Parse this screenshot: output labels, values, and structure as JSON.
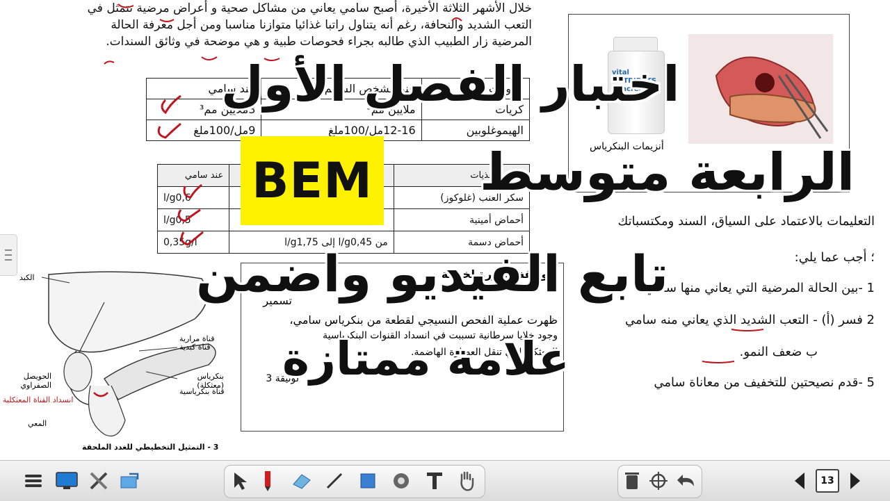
{
  "paragraph": {
    "lines": [
      "خلال الأشهر الثلاثة الأخيرة، أصبح سامي يعاني من مشاكل صحية و أعراض مرضية تتمثل في",
      "التعب الشديد والنحافة، رغم أنه يتناول راتبا غذائيا متوازنا مناسبا ومن أجل معرفة الحالة",
      "المرضية زار الطبيب الذي طالبه بجراء فحوصات طبية و هي موضحة في وثائق السندات."
    ]
  },
  "table1": {
    "header": [
      "مكونات الدم",
      "عند الشخص السليم",
      "عند سامي"
    ],
    "rows": [
      [
        "كريات",
        "ملايين مم³",
        "3ملايين مم³"
      ],
      [
        "الهيموغلوبين",
        "12-16مل/100ملغ",
        "9مل/100ملغ"
      ]
    ]
  },
  "table2": {
    "header": [
      "كمية المغذيات",
      "",
      "عند سامي"
    ],
    "rows": [
      [
        "سكر العنب (غلوكوز)",
        "",
        "l/g0,6"
      ],
      [
        "أحماض أمينية",
        "",
        "l/g0,5"
      ],
      [
        "أحماض دسمة",
        "من l/g0,45 إلى l/g1,75",
        "0,35g/l"
      ]
    ]
  },
  "diagram": {
    "labels": [
      "الكبد",
      "قناة كبدية",
      "قناة مرارية",
      "الحويصل الصفراوي",
      "انسداد القناة المعثكلية",
      "بنكرياس (معثكلة)",
      "قناة بنكرياسية",
      "المعي"
    ],
    "caption": "3 - التمثيل التخطيطي للغدد الملحقة"
  },
  "doc_panel": {
    "lines": [
      "الوثيقة: صورة لخزعة",
      "تسمير",
      "ظهرت عملية الفحص النسيجي لقطعة من بنكرياس سامي،",
      "وجود خلايا سرطانية تسببت في انسداد القنوات البنكرياسية",
      "المعثكلة التي تنقل العصارة الهاضمة.",
      "لوثيقة 3"
    ]
  },
  "image_box": {
    "bottle_text": "vital NUTRIENTS pancreatic enzymes",
    "caption": "أنزيمات البنكرياس"
  },
  "questions": {
    "instructions": "التعليمات بالاعتماد على السياق، السند ومكتسباتك",
    "prompt": "؛ أجب عما يلي:",
    "q1": "1 -بين الحالة المرضية التي يعاني منها سامي",
    "q2": "2 فسر (أ) - التعب الشديد الذي يعاني منه سامي",
    "q2b": "ب ضعف النمو.",
    "q5": "5 -قدم نصيحتين للتخفيف من معاناة سامي"
  },
  "overlay": {
    "line1": "اختبار الفصل الأول",
    "line2": "الرابعة متوسط",
    "bem": "BEM",
    "line3": "تابع الفيديو واضمن",
    "line4": "علامة ممتازة"
  },
  "toolbar": {
    "page_number": "13"
  },
  "colors": {
    "overlay_text": "#101010",
    "bem_background": "#fff200",
    "teacher_ink": "#c0141e",
    "toolbar_bg": "#e3e3e3"
  }
}
